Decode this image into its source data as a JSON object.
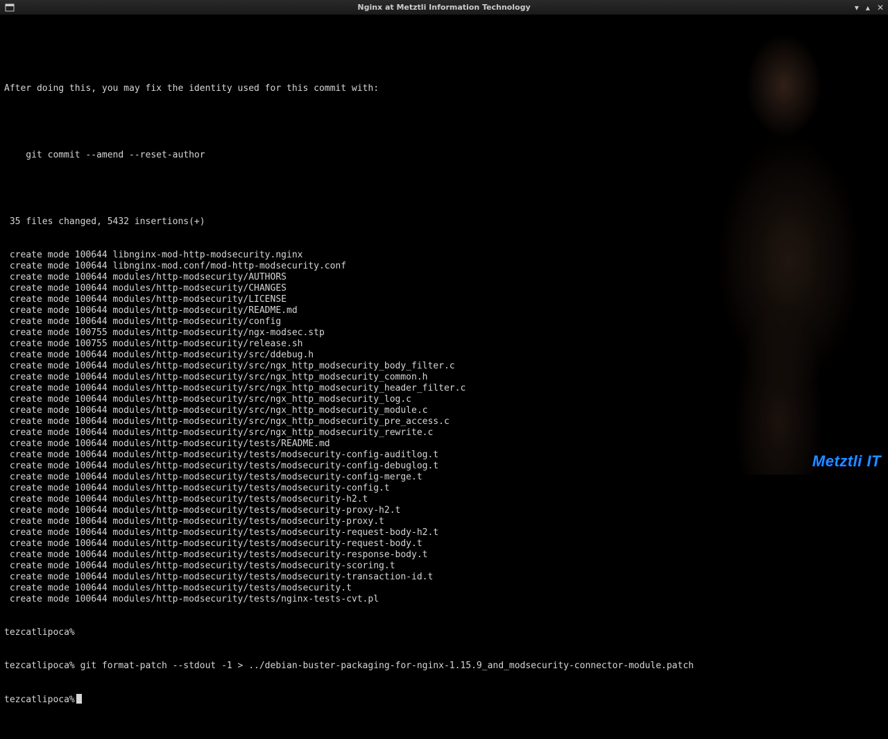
{
  "window": {
    "title": "Nginx at Metztli Information Technology"
  },
  "watermark": "Metztli IT",
  "terminal": {
    "intro1": "After doing this, you may fix the identity used for this commit with:",
    "intro2": "    git commit --amend --reset-author",
    "summary": " 35 files changed, 5432 insertions(+)",
    "creates": [
      " create mode 100644 libnginx-mod-http-modsecurity.nginx",
      " create mode 100644 libnginx-mod.conf/mod-http-modsecurity.conf",
      " create mode 100644 modules/http-modsecurity/AUTHORS",
      " create mode 100644 modules/http-modsecurity/CHANGES",
      " create mode 100644 modules/http-modsecurity/LICENSE",
      " create mode 100644 modules/http-modsecurity/README.md",
      " create mode 100644 modules/http-modsecurity/config",
      " create mode 100755 modules/http-modsecurity/ngx-modsec.stp",
      " create mode 100755 modules/http-modsecurity/release.sh",
      " create mode 100644 modules/http-modsecurity/src/ddebug.h",
      " create mode 100644 modules/http-modsecurity/src/ngx_http_modsecurity_body_filter.c",
      " create mode 100644 modules/http-modsecurity/src/ngx_http_modsecurity_common.h",
      " create mode 100644 modules/http-modsecurity/src/ngx_http_modsecurity_header_filter.c",
      " create mode 100644 modules/http-modsecurity/src/ngx_http_modsecurity_log.c",
      " create mode 100644 modules/http-modsecurity/src/ngx_http_modsecurity_module.c",
      " create mode 100644 modules/http-modsecurity/src/ngx_http_modsecurity_pre_access.c",
      " create mode 100644 modules/http-modsecurity/src/ngx_http_modsecurity_rewrite.c",
      " create mode 100644 modules/http-modsecurity/tests/README.md",
      " create mode 100644 modules/http-modsecurity/tests/modsecurity-config-auditlog.t",
      " create mode 100644 modules/http-modsecurity/tests/modsecurity-config-debuglog.t",
      " create mode 100644 modules/http-modsecurity/tests/modsecurity-config-merge.t",
      " create mode 100644 modules/http-modsecurity/tests/modsecurity-config.t",
      " create mode 100644 modules/http-modsecurity/tests/modsecurity-h2.t",
      " create mode 100644 modules/http-modsecurity/tests/modsecurity-proxy-h2.t",
      " create mode 100644 modules/http-modsecurity/tests/modsecurity-proxy.t",
      " create mode 100644 modules/http-modsecurity/tests/modsecurity-request-body-h2.t",
      " create mode 100644 modules/http-modsecurity/tests/modsecurity-request-body.t",
      " create mode 100644 modules/http-modsecurity/tests/modsecurity-response-body.t",
      " create mode 100644 modules/http-modsecurity/tests/modsecurity-scoring.t",
      " create mode 100644 modules/http-modsecurity/tests/modsecurity-transaction-id.t",
      " create mode 100644 modules/http-modsecurity/tests/modsecurity.t",
      " create mode 100644 modules/http-modsecurity/tests/nginx-tests-cvt.pl"
    ],
    "prompt1": "tezcatlipoca%",
    "cmd": "tezcatlipoca% git format-patch --stdout -1 > ../debian-buster-packaging-for-nginx-1.15.9_and_modsecurity-connector-module.patch",
    "prompt2": "tezcatlipoca%"
  }
}
